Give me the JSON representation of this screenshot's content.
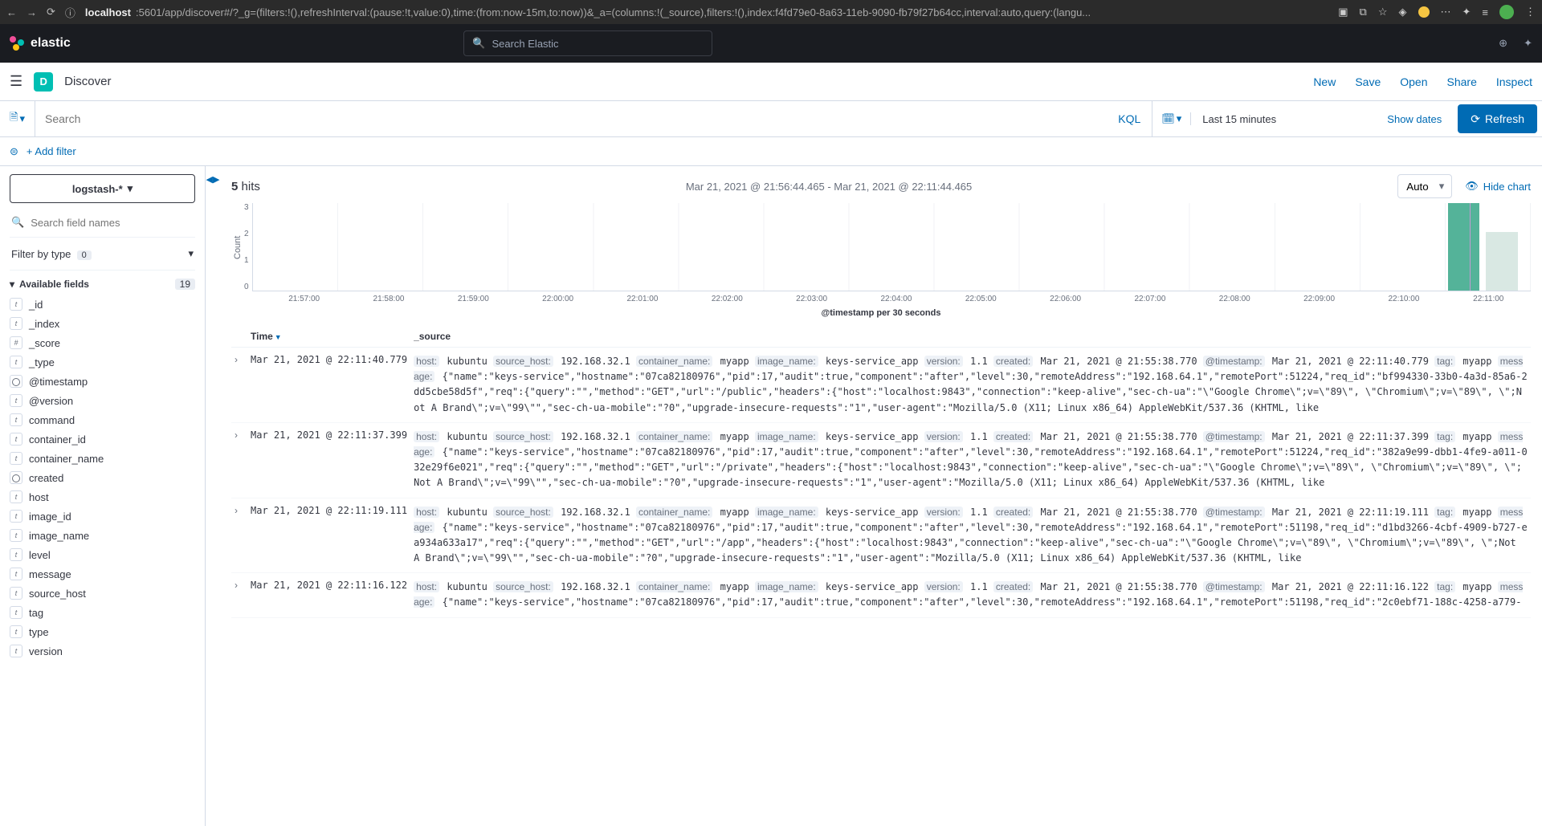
{
  "browser": {
    "url_host": "localhost",
    "url_rest": ":5601/app/discover#/?_g=(filters:!(),refreshInterval:(pause:!t,value:0),time:(from:now-15m,to:now))&_a=(columns:!(_source),filters:!(),index:f4fd79e0-8a63-11eb-9090-fb79f27b64cc,interval:auto,query:(langu..."
  },
  "elastic": {
    "brand": "elastic",
    "search_placeholder": "Search Elastic"
  },
  "app": {
    "badge": "D",
    "title": "Discover",
    "links": [
      "New",
      "Save",
      "Open",
      "Share",
      "Inspect"
    ]
  },
  "query": {
    "search_placeholder": "Search",
    "kql": "KQL",
    "time": "Last 15 minutes",
    "show_dates": "Show dates",
    "refresh": "Refresh"
  },
  "filter": {
    "add": "+ Add filter"
  },
  "sidebar": {
    "pattern": "logstash-*",
    "field_search_placeholder": "Search field names",
    "filter_type": "Filter by type",
    "filter_type_count": "0",
    "avail": "Available fields",
    "avail_count": "19",
    "fields": [
      {
        "t": "t",
        "n": "_id"
      },
      {
        "t": "t",
        "n": "_index"
      },
      {
        "t": "#",
        "n": "_score"
      },
      {
        "t": "t",
        "n": "_type"
      },
      {
        "t": "d",
        "n": "@timestamp"
      },
      {
        "t": "t",
        "n": "@version"
      },
      {
        "t": "t",
        "n": "command"
      },
      {
        "t": "t",
        "n": "container_id"
      },
      {
        "t": "t",
        "n": "container_name"
      },
      {
        "t": "d",
        "n": "created"
      },
      {
        "t": "t",
        "n": "host"
      },
      {
        "t": "t",
        "n": "image_id"
      },
      {
        "t": "t",
        "n": "image_name"
      },
      {
        "t": "t",
        "n": "level"
      },
      {
        "t": "t",
        "n": "message"
      },
      {
        "t": "t",
        "n": "source_host"
      },
      {
        "t": "t",
        "n": "tag"
      },
      {
        "t": "t",
        "n": "type"
      },
      {
        "t": "t",
        "n": "version"
      }
    ]
  },
  "hits": {
    "count": "5",
    "label": "hits",
    "range": "Mar 21, 2021 @ 21:56:44.465 - Mar 21, 2021 @ 22:11:44.465",
    "interval": "Auto",
    "hide": "Hide chart"
  },
  "chart_data": {
    "type": "bar",
    "ylabel": "Count",
    "y_ticks": [
      "3",
      "2",
      "1",
      "0"
    ],
    "x_ticks": [
      "21:57:00",
      "21:58:00",
      "21:59:00",
      "22:00:00",
      "22:01:00",
      "22:02:00",
      "22:03:00",
      "22:04:00",
      "22:05:00",
      "22:06:00",
      "22:07:00",
      "22:08:00",
      "22:09:00",
      "22:10:00",
      "22:11:00"
    ],
    "xlabel": "@timestamp per 30 seconds",
    "bars": [
      {
        "pos_pct": 93.5,
        "h": 3,
        "dim": false
      },
      {
        "pos_pct": 96.5,
        "h": 2,
        "dim": true
      }
    ],
    "vline_pct": 95.2,
    "ymax": 3
  },
  "table": {
    "th_time": "Time",
    "th_source": "_source",
    "rows": [
      {
        "ts": "Mar 21, 2021 @ 22:11:40.779",
        "kv": {
          "host": "kubuntu",
          "source_host": "192.168.32.1",
          "container_name": "myapp",
          "image_name": "keys-service_app",
          "version": "1.1",
          "created": "Mar 21, 2021 @ 21:55:38.770",
          "@timestamp": "Mar 21, 2021 @ 22:11:40.779",
          "tag": "myapp",
          "message": "{\"name\":\"keys-service\",\"hostname\":\"07ca82180976\",\"pid\":17,\"audit\":true,\"component\":\"after\",\"level\":30,\"remoteAddress\":\"192.168.64.1\",\"remotePort\":51224,\"req_id\":\"bf994330-33b0-4a3d-85a6-2dd5cbe58d5f\",\"req\":{\"query\":\"\",\"method\":\"GET\",\"url\":\"/public\",\"headers\":{\"host\":\"localhost:9843\",\"connection\":\"keep-alive\",\"sec-ch-ua\":\"\\\"Google Chrome\\\";v=\\\"89\\\", \\\"Chromium\\\";v=\\\"89\\\", \\\";Not A Brand\\\";v=\\\"99\\\"\",\"sec-ch-ua-mobile\":\"?0\",\"upgrade-insecure-requests\":\"1\",\"user-agent\":\"Mozilla/5.0 (X11; Linux x86_64) AppleWebKit/537.36 (KHTML, like"
        }
      },
      {
        "ts": "Mar 21, 2021 @ 22:11:37.399",
        "kv": {
          "host": "kubuntu",
          "source_host": "192.168.32.1",
          "container_name": "myapp",
          "image_name": "keys-service_app",
          "version": "1.1",
          "created": "Mar 21, 2021 @ 21:55:38.770",
          "@timestamp": "Mar 21, 2021 @ 22:11:37.399",
          "tag": "myapp",
          "message": "{\"name\":\"keys-service\",\"hostname\":\"07ca82180976\",\"pid\":17,\"audit\":true,\"component\":\"after\",\"level\":30,\"remoteAddress\":\"192.168.64.1\",\"remotePort\":51224,\"req_id\":\"382a9e99-dbb1-4fe9-a011-032e29f6e021\",\"req\":{\"query\":\"\",\"method\":\"GET\",\"url\":\"/private\",\"headers\":{\"host\":\"localhost:9843\",\"connection\":\"keep-alive\",\"sec-ch-ua\":\"\\\"Google Chrome\\\";v=\\\"89\\\", \\\"Chromium\\\";v=\\\"89\\\", \\\";Not A Brand\\\";v=\\\"99\\\"\",\"sec-ch-ua-mobile\":\"?0\",\"upgrade-insecure-requests\":\"1\",\"user-agent\":\"Mozilla/5.0 (X11; Linux x86_64) AppleWebKit/537.36 (KHTML, like"
        }
      },
      {
        "ts": "Mar 21, 2021 @ 22:11:19.111",
        "kv": {
          "host": "kubuntu",
          "source_host": "192.168.32.1",
          "container_name": "myapp",
          "image_name": "keys-service_app",
          "version": "1.1",
          "created": "Mar 21, 2021 @ 21:55:38.770",
          "@timestamp": "Mar 21, 2021 @ 22:11:19.111",
          "tag": "myapp",
          "message": "{\"name\":\"keys-service\",\"hostname\":\"07ca82180976\",\"pid\":17,\"audit\":true,\"component\":\"after\",\"level\":30,\"remoteAddress\":\"192.168.64.1\",\"remotePort\":51198,\"req_id\":\"d1bd3266-4cbf-4909-b727-ea934a633a17\",\"req\":{\"query\":\"\",\"method\":\"GET\",\"url\":\"/app\",\"headers\":{\"host\":\"localhost:9843\",\"connection\":\"keep-alive\",\"sec-ch-ua\":\"\\\"Google Chrome\\\";v=\\\"89\\\", \\\"Chromium\\\";v=\\\"89\\\", \\\";Not A Brand\\\";v=\\\"99\\\"\",\"sec-ch-ua-mobile\":\"?0\",\"upgrade-insecure-requests\":\"1\",\"user-agent\":\"Mozilla/5.0 (X11; Linux x86_64) AppleWebKit/537.36 (KHTML, like"
        }
      },
      {
        "ts": "Mar 21, 2021 @ 22:11:16.122",
        "kv": {
          "host": "kubuntu",
          "source_host": "192.168.32.1",
          "container_name": "myapp",
          "image_name": "keys-service_app",
          "version": "1.1",
          "created": "Mar 21, 2021 @ 21:55:38.770",
          "@timestamp": "Mar 21, 2021 @ 22:11:16.122",
          "tag": "myapp",
          "message": "{\"name\":\"keys-service\",\"hostname\":\"07ca82180976\",\"pid\":17,\"audit\":true,\"component\":\"after\",\"level\":30,\"remoteAddress\":\"192.168.64.1\",\"remotePort\":51198,\"req_id\":\"2c0ebf71-188c-4258-a779-"
        }
      }
    ]
  }
}
